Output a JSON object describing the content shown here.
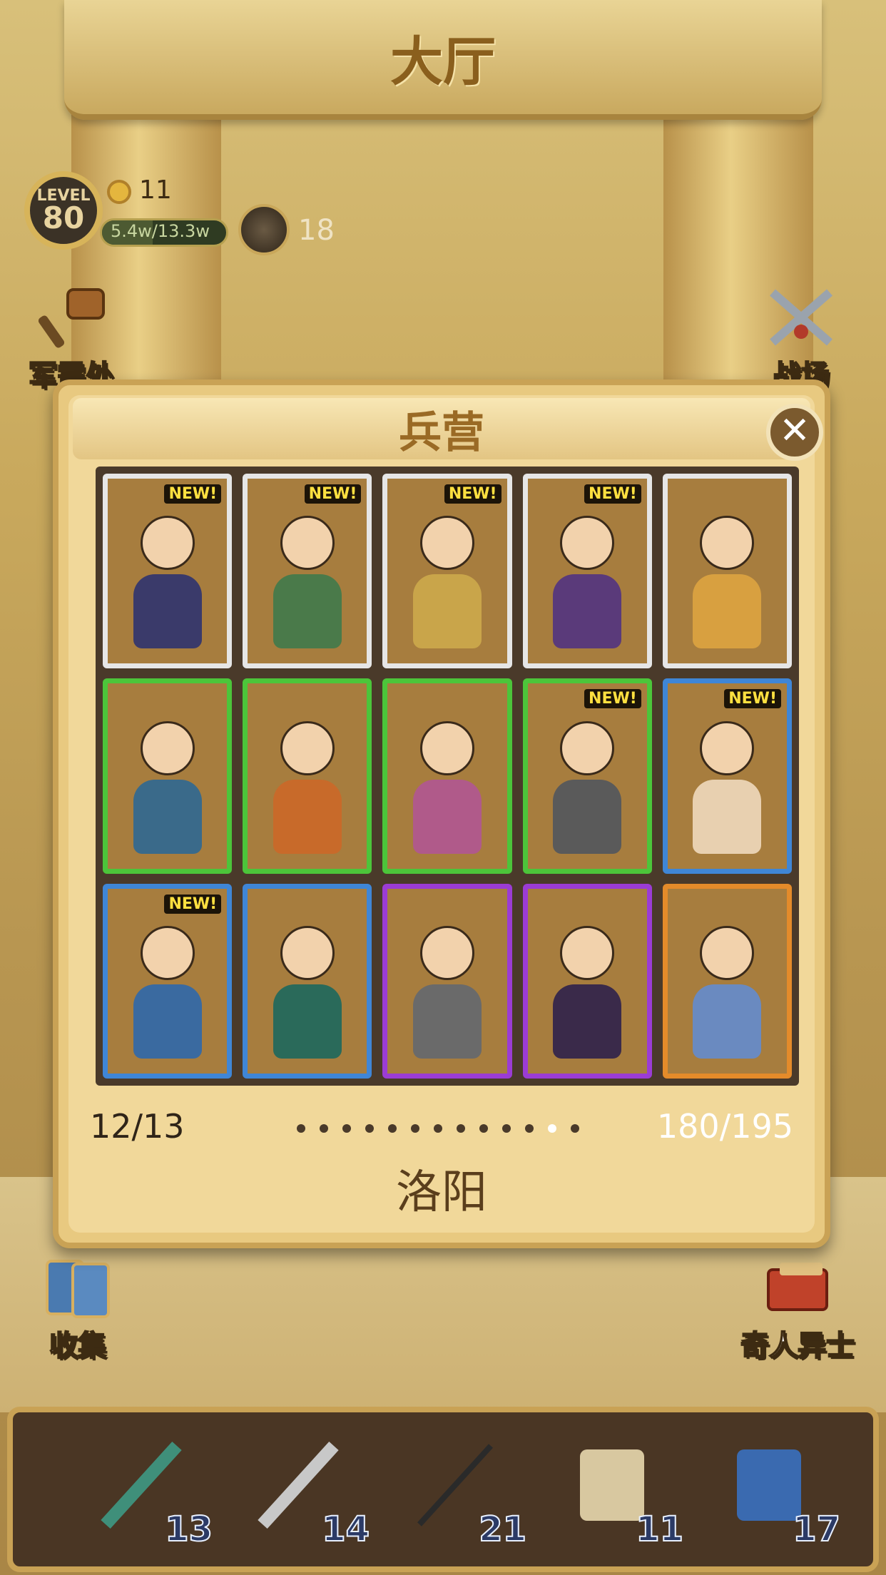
{
  "header": {
    "title": "大厅"
  },
  "player": {
    "level_label": "LEVEL",
    "level": "80",
    "coins": "11",
    "exp_text": "5.4w/13.3w",
    "exp_fraction": 0.41,
    "tokens": "18"
  },
  "corner_buttons": {
    "supply": "军需处",
    "battlefield": "战场",
    "collection": "收集",
    "heroes": "奇人异士"
  },
  "dialog": {
    "title": "兵营",
    "close": "✕",
    "page": "12/13",
    "count": "180/195",
    "city": "洛阳",
    "dot_count": 13,
    "active_dot": 11,
    "cards": [
      {
        "rarity": "silver",
        "new": "NEW!",
        "color": "#3a3a6a"
      },
      {
        "rarity": "silver",
        "new": "NEW!",
        "color": "#4a7a4a"
      },
      {
        "rarity": "silver",
        "new": "NEW!",
        "color": "#c9a54a"
      },
      {
        "rarity": "silver",
        "new": "NEW!",
        "color": "#5a3a7a"
      },
      {
        "rarity": "silver",
        "new": "",
        "color": "#d8a040"
      },
      {
        "rarity": "green",
        "new": "",
        "color": "#3a6a8a"
      },
      {
        "rarity": "green",
        "new": "",
        "color": "#c86a2a"
      },
      {
        "rarity": "green",
        "new": "",
        "color": "#b05a8a"
      },
      {
        "rarity": "green",
        "new": "NEW!",
        "color": "#5a5a5a"
      },
      {
        "rarity": "blue",
        "new": "NEW!",
        "color": "#e8d0b0"
      },
      {
        "rarity": "blue",
        "new": "NEW!",
        "color": "#3a6aa0"
      },
      {
        "rarity": "blue",
        "new": "",
        "color": "#2a6a5a"
      },
      {
        "rarity": "purple",
        "new": "",
        "color": "#6a6a6a"
      },
      {
        "rarity": "purple",
        "new": "",
        "color": "#3a2a4a"
      },
      {
        "rarity": "orange",
        "new": "",
        "color": "#6a8ac0"
      }
    ]
  },
  "equipment": [
    {
      "name": "sword-icon",
      "count": "13"
    },
    {
      "name": "saber-icon",
      "count": "14"
    },
    {
      "name": "spear-icon",
      "count": "21"
    },
    {
      "name": "armor-icon",
      "count": "11"
    },
    {
      "name": "book-icon",
      "count": "17"
    }
  ]
}
